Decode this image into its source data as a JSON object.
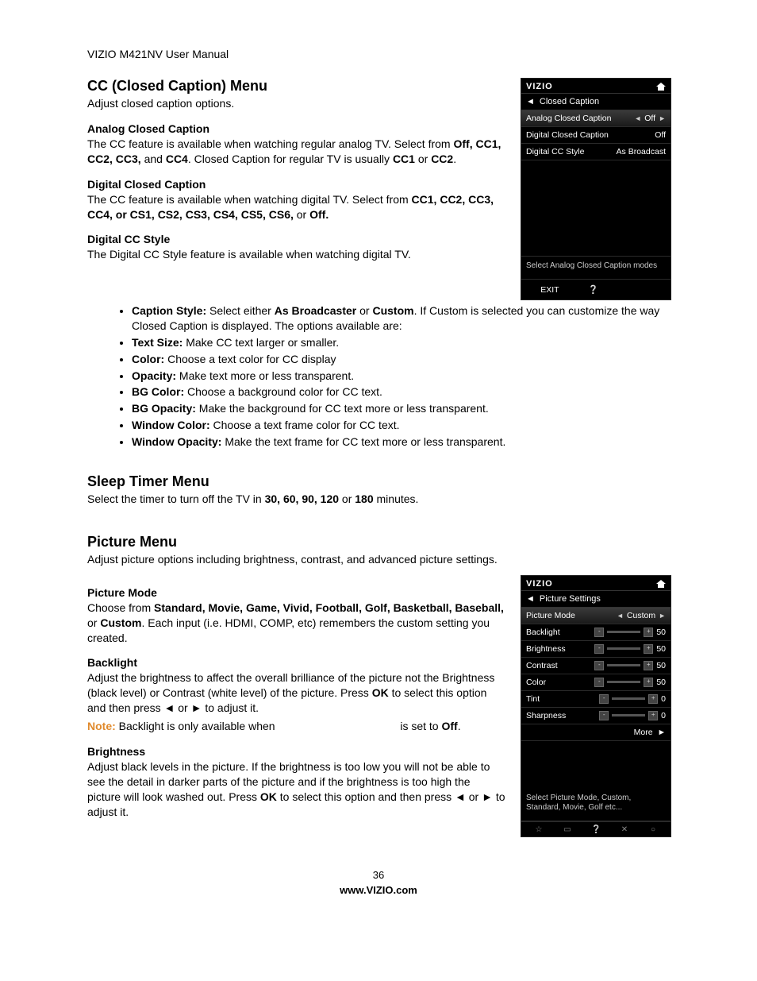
{
  "header": "VIZIO M421NV User Manual",
  "cc_menu": {
    "title": "CC (Closed Caption) Menu",
    "intro": "Adjust closed caption options.",
    "analog": {
      "title": "Analog Closed Caption",
      "p1a": "The CC feature is available when watching regular analog TV. Select from ",
      "p1b": "Off, CC1, CC2, CC3,",
      "p1c": " and ",
      "p1d": "CC4",
      "p1e": ". Closed Caption for regular TV is usually ",
      "p1f": "CC1",
      "p1g": " or ",
      "p1h": "CC2",
      "p1i": "."
    },
    "digital": {
      "title": "Digital Closed Caption",
      "p1a": "The CC feature is available when watching digital TV. Select from ",
      "p1b": "CC1, CC2, CC3, CC4, or CS1, CS2, CS3, CS4, CS5, CS6,",
      "p1c": " or ",
      "p1d": "Off."
    },
    "style": {
      "title": "Digital CC Style",
      "intro": "The Digital CC Style feature is available when watching digital TV.",
      "b1": {
        "label": "Caption Style:",
        "rest": " Select either ",
        "bold1": "As Broadcaster",
        "rest2": " or ",
        "bold2": "Custom",
        "rest3": ". If Custom is selected you can customize the way Closed Caption is displayed. The options available are:"
      },
      "b2": {
        "label": "Text Size:",
        "rest": " Make CC text larger or smaller."
      },
      "b3": {
        "label": "Color:",
        "rest": " Choose a text color for CC display"
      },
      "b4": {
        "label": "Opacity:",
        "rest": " Make text more or less transparent."
      },
      "b5": {
        "label": "BG Color:",
        "rest": " Choose a background color for CC text."
      },
      "b6": {
        "label": "BG Opacity:",
        "rest": " Make the background for CC text more or less transparent."
      },
      "b7": {
        "label": "Window Color:",
        "rest": " Choose a text frame color for CC text."
      },
      "b8": {
        "label": "Window Opacity:",
        "rest": " Make the text frame for CC text more or less transparent."
      }
    }
  },
  "sleep_menu": {
    "title": "Sleep Timer Menu",
    "p1a": "Select the timer to turn off the TV in ",
    "p1b": "30, 60, 90, 120",
    "p1c": " or ",
    "p1d": "180",
    "p1e": " minutes."
  },
  "picture_menu": {
    "title": "Picture Menu",
    "intro": "Adjust picture options including brightness, contrast, and advanced picture settings.",
    "mode": {
      "title": "Picture Mode",
      "p1a": "Choose from ",
      "p1b": "Standard, Movie, Game, Vivid, Football, Golf, Basketball, Baseball,",
      "p1c": " or ",
      "p1d": "Custom",
      "p1e": ". Each input (i.e. HDMI, COMP, etc) remembers the custom setting you created."
    },
    "backlight": {
      "title": "Backlight",
      "p1a": "Adjust the brightness to affect the overall brilliance of the picture not the Brightness (black level) or Contrast (white level) of the picture. Press ",
      "p1b": "OK",
      "p1c": " to select this option and then press ◄ or ► to adjust it.",
      "note_label": "Note:",
      "note_a": " Backlight is only available when ",
      "note_b": " is set to ",
      "note_c": "Off",
      "note_d": "."
    },
    "brightness": {
      "title": "Brightness",
      "p1a": "Adjust black levels in the picture. If the brightness is too low you will not be able to see the detail in darker parts of the picture and if the brightness is too high the picture will look washed out. Press ",
      "p1b": "OK",
      "p1c": " to select this option and then press ◄ or ► to adjust it."
    }
  },
  "osd_cc": {
    "brand": "VIZIO",
    "crumb": "Closed Caption",
    "rows": [
      {
        "label": "Analog Closed Caption",
        "value": "Off",
        "highlight": true,
        "arrows": true
      },
      {
        "label": "Digital Closed Caption",
        "value": "Off"
      },
      {
        "label": "Digital CC Style",
        "value": "As Broadcast"
      }
    ],
    "hint": "Select Analog Closed Caption modes",
    "exit": "EXIT"
  },
  "osd_pic": {
    "brand": "VIZIO",
    "crumb": "Picture Settings",
    "rows": [
      {
        "label": "Picture Mode",
        "value": "Custom",
        "highlight": true,
        "arrows": true
      },
      {
        "label": "Backlight",
        "value": "50",
        "slider": 50
      },
      {
        "label": "Brightness",
        "value": "50",
        "slider": 50
      },
      {
        "label": "Contrast",
        "value": "50",
        "slider": 50
      },
      {
        "label": "Color",
        "value": "50",
        "slider": 50
      },
      {
        "label": "Tint",
        "value": "0",
        "slider": 0
      },
      {
        "label": "Sharpness",
        "value": "0",
        "slider": 0
      }
    ],
    "more": "More",
    "hint": "Select Picture Mode, Custom, Standard, Movie, Golf etc..."
  },
  "footer": {
    "page_no": "36",
    "url": "www.VIZIO.com"
  }
}
